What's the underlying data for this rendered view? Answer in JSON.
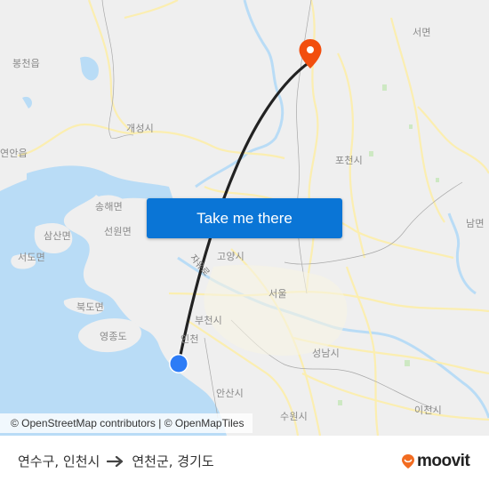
{
  "map": {
    "place_labels": [
      {
        "id": "bongcheon",
        "text": "봉천읍"
      },
      {
        "id": "gaeseong",
        "text": "개성시"
      },
      {
        "id": "yeonan",
        "text": "연안읍"
      },
      {
        "id": "seomyeon",
        "text": "서면"
      },
      {
        "id": "pocheon",
        "text": "포천시"
      },
      {
        "id": "songhae",
        "text": "송해면"
      },
      {
        "id": "seonwon",
        "text": "선원면"
      },
      {
        "id": "samsan",
        "text": "삼산면"
      },
      {
        "id": "seodo",
        "text": "서도면"
      },
      {
        "id": "goyang",
        "text": "고양시"
      },
      {
        "id": "nammyeon",
        "text": "남면"
      },
      {
        "id": "seoul",
        "text": "서울"
      },
      {
        "id": "bukdo",
        "text": "북도면"
      },
      {
        "id": "yeongjongdo",
        "text": "영종도"
      },
      {
        "id": "bucheon",
        "text": "부천시"
      },
      {
        "id": "incheon",
        "text": "인천"
      },
      {
        "id": "seongnam",
        "text": "성남시"
      },
      {
        "id": "ansan",
        "text": "안산시"
      },
      {
        "id": "suwon",
        "text": "수원시"
      },
      {
        "id": "icheon",
        "text": "이천시"
      }
    ],
    "road_labels": [
      {
        "id": "jayuro",
        "text": "자유로"
      }
    ],
    "origin_marker": {
      "icon": "origin-dot-icon",
      "color": "#2d7cf6"
    },
    "destination_marker": {
      "icon": "destination-pin-icon",
      "color": "#f24e0e"
    },
    "route_line_color": "#222222",
    "cta_button": {
      "label": "Take me there",
      "color": "#0a75d6"
    },
    "attribution": "© OpenStreetMap contributors | © OpenMapTiles"
  },
  "footer": {
    "origin": "연수구, 인천시",
    "arrow_icon": "arrow-right-icon",
    "destination": "연천군, 경기도",
    "brand": {
      "name": "moovit",
      "icon": "moovit-logo-icon",
      "accent": "#f26c21"
    }
  }
}
